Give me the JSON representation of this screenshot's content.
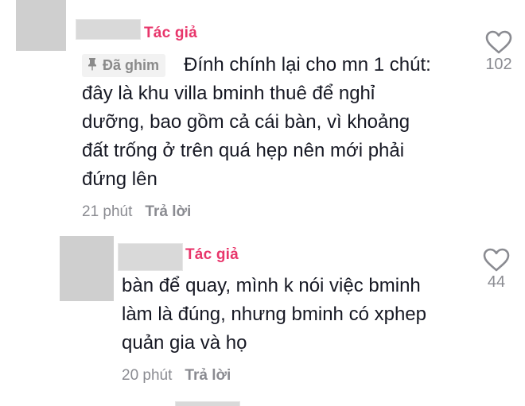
{
  "comment": {
    "author_label": "Tác giả",
    "pinned_label": "Đã ghim",
    "text_lines": [
      "Đính chính lại cho mn 1 chút:",
      "đây là khu villa bminh thuê để nghỉ",
      "dưỡng, bao gồm cả cái bàn, vì khoảng",
      "đất trống ở trên quá hẹp nên mới phải",
      "đứng lên"
    ],
    "time": "21 phút",
    "reply_label": "Trả lời",
    "like_count": "102"
  },
  "reply": {
    "author_label": "Tác giả",
    "text_lines": [
      "bàn để quay, mình k nói việc bminh",
      "làm là đúng, nhưng bminh có xphep",
      "quản gia và họ"
    ],
    "time": "20 phút",
    "reply_label": "Trả lời",
    "like_count": "44"
  },
  "icons": {
    "like": "heart-outline-icon",
    "pin": "pin-icon"
  },
  "colors": {
    "author_badge": "#e8366b",
    "text": "#161823",
    "meta": "#8a8b91",
    "avatar_placeholder": "#cfcfcf"
  }
}
